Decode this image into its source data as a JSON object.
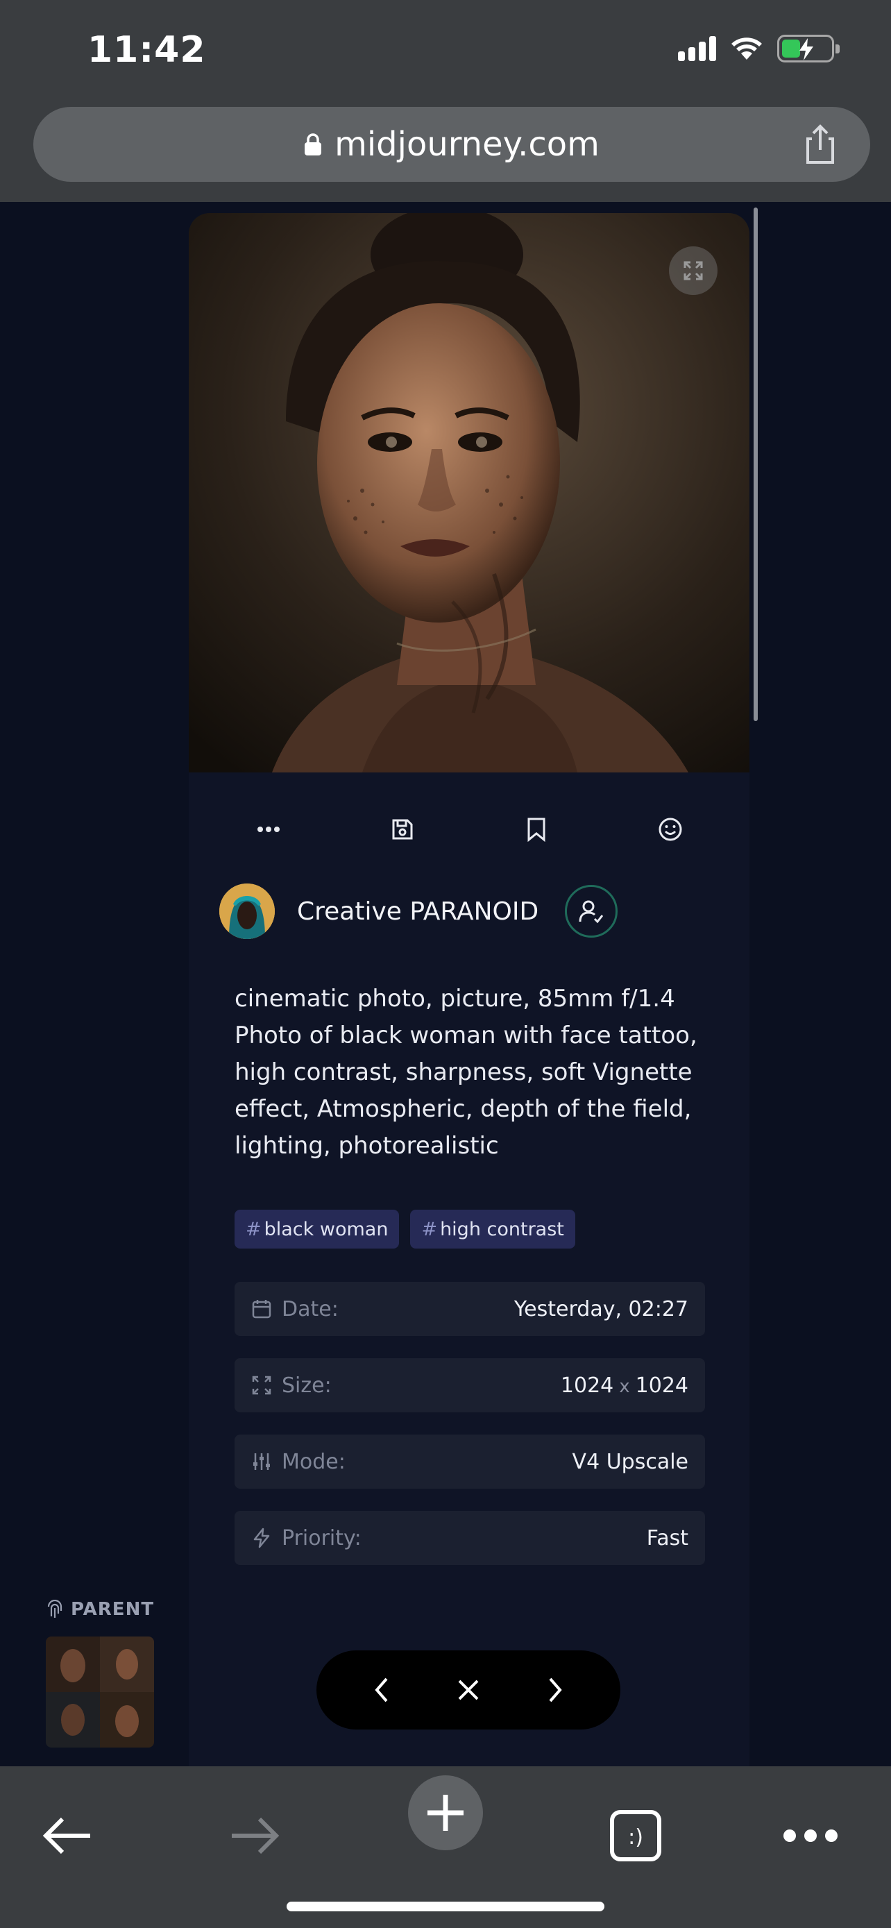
{
  "status_bar": {
    "time": "11:42"
  },
  "browser": {
    "url": "midjourney.com"
  },
  "post": {
    "author": "Creative PARANOID",
    "prompt": "cinematic photo, picture, 85mm f/1.4 Photo of black woman with face tattoo, high contrast, sharpness, soft Vignette effect, Atmospheric, depth of the field, lighting, photorealistic",
    "tags": [
      {
        "hash": "#",
        "text": "black woman"
      },
      {
        "hash": "#",
        "text": "high contrast"
      }
    ],
    "meta": {
      "date": {
        "label": "Date:",
        "value": "Yesterday, 02:27"
      },
      "size": {
        "label": "Size:",
        "w": "1024",
        "x": "x",
        "h": "1024"
      },
      "mode": {
        "label": "Mode:",
        "value": "V4 Upscale"
      },
      "priority": {
        "label": "Priority:",
        "value": "Fast"
      }
    },
    "parent_label": "PARENT"
  },
  "toolbar": {
    "tabs_icon_text": ":)"
  },
  "colors": {
    "accent_green": "#1f6b5a",
    "tag_bg": "#262a56",
    "meta_bg": "#1b2030",
    "battery": "#34c759"
  },
  "icons": [
    "lock-icon",
    "share-icon",
    "expand-icon",
    "more-icon",
    "save-icon",
    "bookmark-icon",
    "emoji-icon",
    "follow-user-icon",
    "calendar-icon",
    "size-icon",
    "mode-icon",
    "priority-icon",
    "fingerprint-icon",
    "chevron-left-icon",
    "close-icon",
    "chevron-right-icon",
    "back-arrow-icon",
    "forward-arrow-icon",
    "plus-icon",
    "tabs-icon",
    "more-dots-icon"
  ]
}
